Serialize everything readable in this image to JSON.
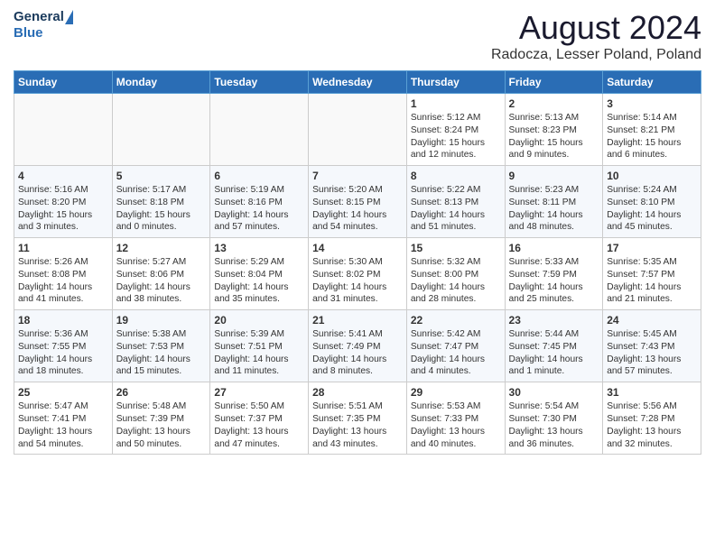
{
  "header": {
    "logo_general": "General",
    "logo_blue": "Blue",
    "title": "August 2024",
    "subtitle": "Radocza, Lesser Poland, Poland"
  },
  "days_of_week": [
    "Sunday",
    "Monday",
    "Tuesday",
    "Wednesday",
    "Thursday",
    "Friday",
    "Saturday"
  ],
  "weeks": [
    [
      {
        "day": "",
        "content": ""
      },
      {
        "day": "",
        "content": ""
      },
      {
        "day": "",
        "content": ""
      },
      {
        "day": "",
        "content": ""
      },
      {
        "day": "1",
        "content": "Sunrise: 5:12 AM\nSunset: 8:24 PM\nDaylight: 15 hours\nand 12 minutes."
      },
      {
        "day": "2",
        "content": "Sunrise: 5:13 AM\nSunset: 8:23 PM\nDaylight: 15 hours\nand 9 minutes."
      },
      {
        "day": "3",
        "content": "Sunrise: 5:14 AM\nSunset: 8:21 PM\nDaylight: 15 hours\nand 6 minutes."
      }
    ],
    [
      {
        "day": "4",
        "content": "Sunrise: 5:16 AM\nSunset: 8:20 PM\nDaylight: 15 hours\nand 3 minutes."
      },
      {
        "day": "5",
        "content": "Sunrise: 5:17 AM\nSunset: 8:18 PM\nDaylight: 15 hours\nand 0 minutes."
      },
      {
        "day": "6",
        "content": "Sunrise: 5:19 AM\nSunset: 8:16 PM\nDaylight: 14 hours\nand 57 minutes."
      },
      {
        "day": "7",
        "content": "Sunrise: 5:20 AM\nSunset: 8:15 PM\nDaylight: 14 hours\nand 54 minutes."
      },
      {
        "day": "8",
        "content": "Sunrise: 5:22 AM\nSunset: 8:13 PM\nDaylight: 14 hours\nand 51 minutes."
      },
      {
        "day": "9",
        "content": "Sunrise: 5:23 AM\nSunset: 8:11 PM\nDaylight: 14 hours\nand 48 minutes."
      },
      {
        "day": "10",
        "content": "Sunrise: 5:24 AM\nSunset: 8:10 PM\nDaylight: 14 hours\nand 45 minutes."
      }
    ],
    [
      {
        "day": "11",
        "content": "Sunrise: 5:26 AM\nSunset: 8:08 PM\nDaylight: 14 hours\nand 41 minutes."
      },
      {
        "day": "12",
        "content": "Sunrise: 5:27 AM\nSunset: 8:06 PM\nDaylight: 14 hours\nand 38 minutes."
      },
      {
        "day": "13",
        "content": "Sunrise: 5:29 AM\nSunset: 8:04 PM\nDaylight: 14 hours\nand 35 minutes."
      },
      {
        "day": "14",
        "content": "Sunrise: 5:30 AM\nSunset: 8:02 PM\nDaylight: 14 hours\nand 31 minutes."
      },
      {
        "day": "15",
        "content": "Sunrise: 5:32 AM\nSunset: 8:00 PM\nDaylight: 14 hours\nand 28 minutes."
      },
      {
        "day": "16",
        "content": "Sunrise: 5:33 AM\nSunset: 7:59 PM\nDaylight: 14 hours\nand 25 minutes."
      },
      {
        "day": "17",
        "content": "Sunrise: 5:35 AM\nSunset: 7:57 PM\nDaylight: 14 hours\nand 21 minutes."
      }
    ],
    [
      {
        "day": "18",
        "content": "Sunrise: 5:36 AM\nSunset: 7:55 PM\nDaylight: 14 hours\nand 18 minutes."
      },
      {
        "day": "19",
        "content": "Sunrise: 5:38 AM\nSunset: 7:53 PM\nDaylight: 14 hours\nand 15 minutes."
      },
      {
        "day": "20",
        "content": "Sunrise: 5:39 AM\nSunset: 7:51 PM\nDaylight: 14 hours\nand 11 minutes."
      },
      {
        "day": "21",
        "content": "Sunrise: 5:41 AM\nSunset: 7:49 PM\nDaylight: 14 hours\nand 8 minutes."
      },
      {
        "day": "22",
        "content": "Sunrise: 5:42 AM\nSunset: 7:47 PM\nDaylight: 14 hours\nand 4 minutes."
      },
      {
        "day": "23",
        "content": "Sunrise: 5:44 AM\nSunset: 7:45 PM\nDaylight: 14 hours\nand 1 minute."
      },
      {
        "day": "24",
        "content": "Sunrise: 5:45 AM\nSunset: 7:43 PM\nDaylight: 13 hours\nand 57 minutes."
      }
    ],
    [
      {
        "day": "25",
        "content": "Sunrise: 5:47 AM\nSunset: 7:41 PM\nDaylight: 13 hours\nand 54 minutes."
      },
      {
        "day": "26",
        "content": "Sunrise: 5:48 AM\nSunset: 7:39 PM\nDaylight: 13 hours\nand 50 minutes."
      },
      {
        "day": "27",
        "content": "Sunrise: 5:50 AM\nSunset: 7:37 PM\nDaylight: 13 hours\nand 47 minutes."
      },
      {
        "day": "28",
        "content": "Sunrise: 5:51 AM\nSunset: 7:35 PM\nDaylight: 13 hours\nand 43 minutes."
      },
      {
        "day": "29",
        "content": "Sunrise: 5:53 AM\nSunset: 7:33 PM\nDaylight: 13 hours\nand 40 minutes."
      },
      {
        "day": "30",
        "content": "Sunrise: 5:54 AM\nSunset: 7:30 PM\nDaylight: 13 hours\nand 36 minutes."
      },
      {
        "day": "31",
        "content": "Sunrise: 5:56 AM\nSunset: 7:28 PM\nDaylight: 13 hours\nand 32 minutes."
      }
    ]
  ]
}
